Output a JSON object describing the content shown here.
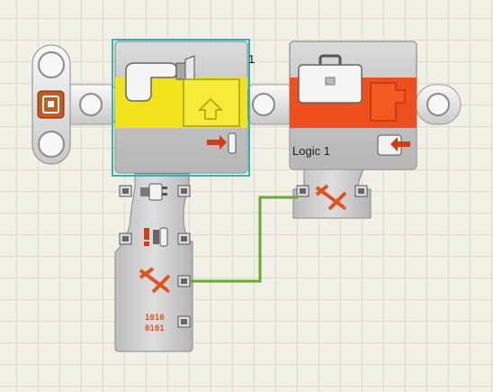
{
  "canvas": {
    "grid_color": "#dedcc9",
    "background_color": "#f1f0e6"
  },
  "start_block": {
    "icon": "start-point-icon",
    "accent_color": "#c8581c"
  },
  "sequence_beam": {
    "color": "#e8e8e8"
  },
  "touch_sensor_block": {
    "port_number": "1",
    "icon": "touch-sensor-hand-icon",
    "action_icon": "bumped-arrow-icon",
    "status_icon": "output-arrow-icon",
    "highlight_color": "#f2e31c",
    "selection_border_color": "#2fb3b3",
    "data_hub_plugs": [
      {
        "icon": "port-plug-icon",
        "type": "number"
      },
      {
        "icon": "action-alert-icon",
        "type": "number"
      },
      {
        "icon": "logic-yes-no-icon",
        "type": "logic"
      },
      {
        "icon": "raw-value-binary-icon",
        "type": "number"
      }
    ]
  },
  "variable_block": {
    "label": "Logic 1",
    "icon": "suitcase-variable-icon",
    "status_icon": "input-arrow-icon",
    "highlight_color": "#ee4f1c",
    "data_hub_plugs": [
      {
        "icon": "logic-yes-no-icon",
        "type": "logic"
      }
    ]
  },
  "data_wire": {
    "type": "logic",
    "color": "#69a92d"
  }
}
